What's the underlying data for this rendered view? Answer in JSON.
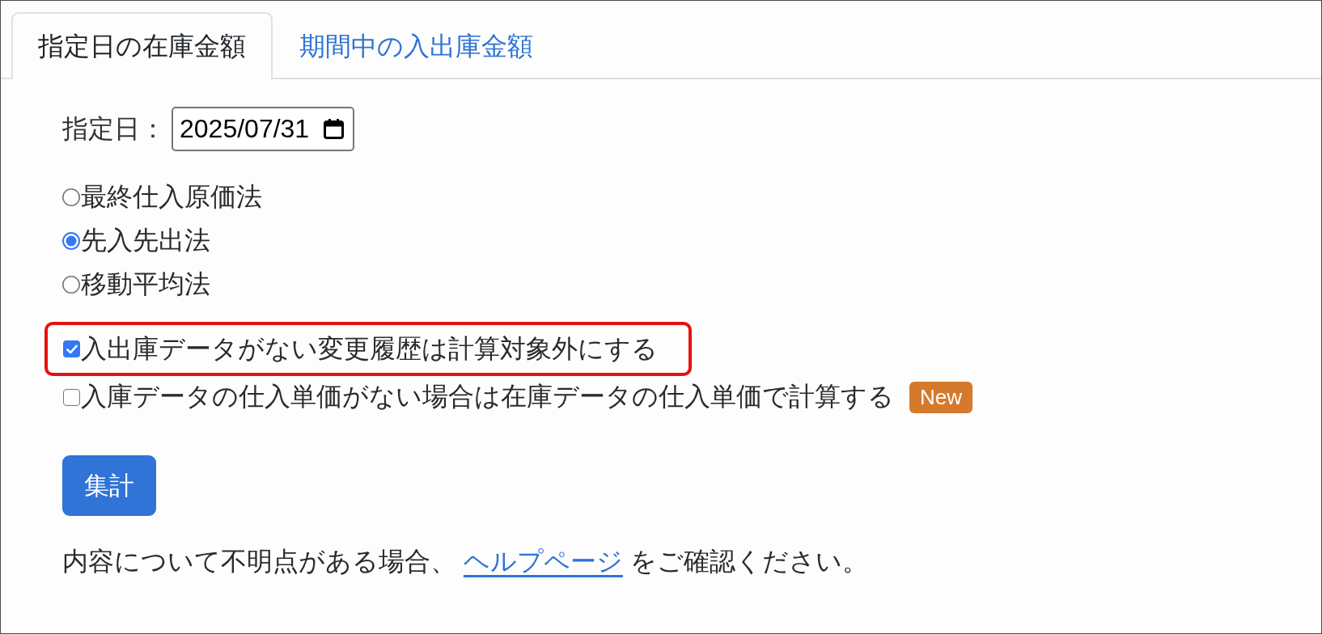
{
  "tabs": [
    {
      "label": "指定日の在庫金額",
      "selected": true
    },
    {
      "label": "期間中の入出庫金額",
      "selected": false
    }
  ],
  "date_field": {
    "label": "指定日：",
    "value": "2025/07/31"
  },
  "methods": [
    {
      "label": "最終仕入原価法",
      "selected": false
    },
    {
      "label": "先入先出法",
      "selected": true
    },
    {
      "label": "移動平均法",
      "selected": false
    }
  ],
  "options": [
    {
      "label": "入出庫データがない変更履歴は計算対象外にする",
      "checked": true,
      "highlighted": true
    },
    {
      "label": "入庫データの仕入単価がない場合は在庫データの仕入単価で計算する",
      "checked": false,
      "highlighted": false,
      "badge": "New"
    }
  ],
  "submit_button": "集計",
  "help": {
    "before": "内容について不明点がある場合、",
    "link": "ヘルプページ",
    "after": "をご確認ください。"
  }
}
